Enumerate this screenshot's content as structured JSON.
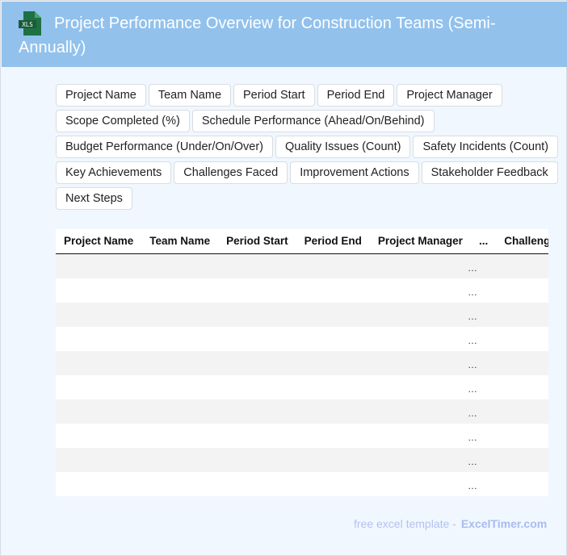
{
  "header": {
    "title": "Project Performance Overview for Construction Teams (Semi-Annually)",
    "logo_text": "XLS",
    "logo_icon": "excel-file-icon"
  },
  "fields": [
    "Project Name",
    "Team Name",
    "Period Start",
    "Period End",
    "Project Manager",
    "Scope Completed (%)",
    "Schedule Performance (Ahead/On/Behind)",
    "Budget Performance (Under/On/Over)",
    "Quality Issues (Count)",
    "Safety Incidents (Count)",
    "Key Achievements",
    "Challenges Faced",
    "Improvement Actions",
    "Stakeholder Feedback",
    "Next Steps"
  ],
  "table": {
    "columns": [
      "Project Name",
      "Team Name",
      "Period Start",
      "Period End",
      "Project Manager",
      "...",
      "Challenges"
    ],
    "rows": [
      "…",
      "…",
      "…",
      "…",
      "…",
      "…",
      "…",
      "…",
      "…",
      "…"
    ]
  },
  "footer": {
    "text": "free excel template -",
    "brand": "ExcelTimer.com"
  },
  "colors": {
    "header": "#92c1ec",
    "background": "#f0f7ff",
    "excel_green": "#1e7145"
  }
}
